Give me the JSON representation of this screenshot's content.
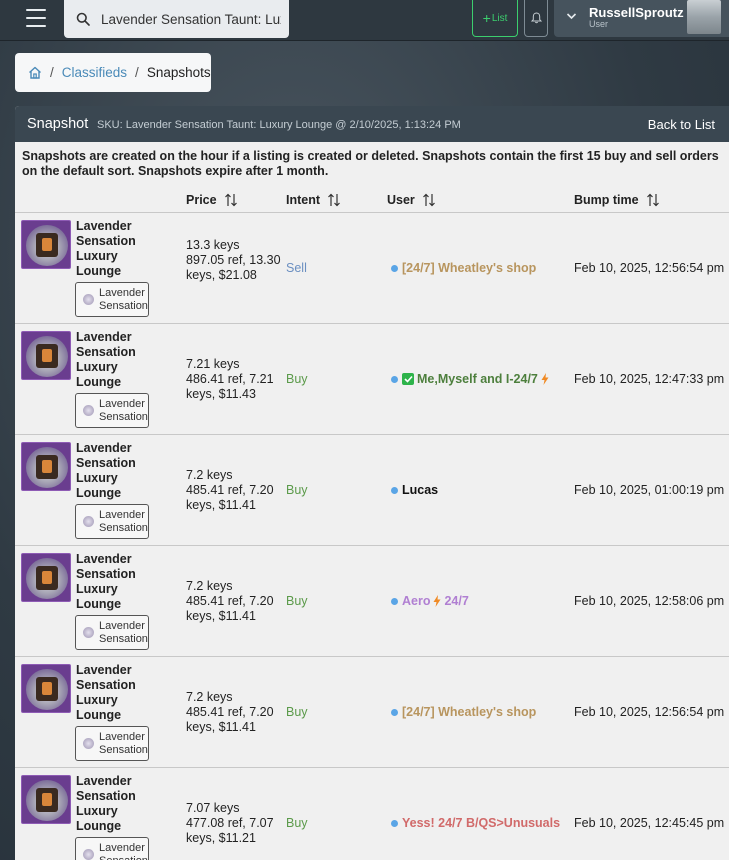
{
  "navbar": {
    "search_value": "Lavender Sensation Taunt: Luxury Lounge",
    "list_button": "List",
    "user_name": "RussellSproutz",
    "user_role": "User"
  },
  "breadcrumb": {
    "link": "Classifieds",
    "current": "Snapshots"
  },
  "panel": {
    "title": "Snapshot",
    "sku": "SKU: Lavender Sensation Taunt: Luxury Lounge @ 2/10/2025, 1:13:24 PM",
    "back_label": "Back to List",
    "notice": "Snapshots are created on the hour if a listing is created or deleted. Snapshots contain the first 15 buy and sell orders on the default sort. Snapshots expire after 1 month."
  },
  "columns": {
    "price": "Price",
    "intent": "Intent",
    "user": "User",
    "bump": "Bump time"
  },
  "rows": [
    {
      "item_name": "Lavender Sensation Luxury Lounge",
      "effect": "Lavender Sensation",
      "price_main": "13.3 keys",
      "price_sub": "897.05 ref, 13.30 keys, $21.08",
      "intent": "Sell",
      "user": "[24/7] Wheatley's shop",
      "user_color": "#b8955e",
      "bump": "Feb 10, 2025, 12:56:54 pm"
    },
    {
      "item_name": "Lavender Sensation Luxury Lounge",
      "effect": "Lavender Sensation",
      "price_main": "7.21 keys",
      "price_sub": "486.41 ref, 7.21 keys, $11.43",
      "intent": "Buy",
      "user": "Me,Myself and I-24/7",
      "user_color": "#4d7f3d",
      "bump": "Feb 10, 2025, 12:47:33 pm"
    },
    {
      "item_name": "Lavender Sensation Luxury Lounge",
      "effect": "Lavender Sensation",
      "price_main": "7.2 keys",
      "price_sub": "485.41 ref, 7.20 keys, $11.41",
      "intent": "Buy",
      "user": "Lucas",
      "user_color": "#111111",
      "bump": "Feb 10, 2025, 01:00:19 pm"
    },
    {
      "item_name": "Lavender Sensation Luxury Lounge",
      "effect": "Lavender Sensation",
      "price_main": "7.2 keys",
      "price_sub": "485.41 ref, 7.20 keys, $11.41",
      "intent": "Buy",
      "user": "Aero",
      "user_suffix": "24/7",
      "user_color": "#b07fd2",
      "bump": "Feb 10, 2025, 12:58:06 pm"
    },
    {
      "item_name": "Lavender Sensation Luxury Lounge",
      "effect": "Lavender Sensation",
      "price_main": "7.2 keys",
      "price_sub": "485.41 ref, 7.20 keys, $11.41",
      "intent": "Buy",
      "user": "[24/7] Wheatley's shop",
      "user_color": "#b8955e",
      "bump": "Feb 10, 2025, 12:56:54 pm"
    },
    {
      "item_name": "Lavender Sensation Luxury Lounge",
      "effect": "Lavender Sensation",
      "price_main": "7.07 keys",
      "price_sub": "477.08 ref, 7.07 keys, $11.21",
      "intent": "Buy",
      "user": "Yess! 24/7 B/QS>Unusuals",
      "user_color": "#d16a6a",
      "bump": "Feb 10, 2025, 12:45:45 pm"
    }
  ]
}
